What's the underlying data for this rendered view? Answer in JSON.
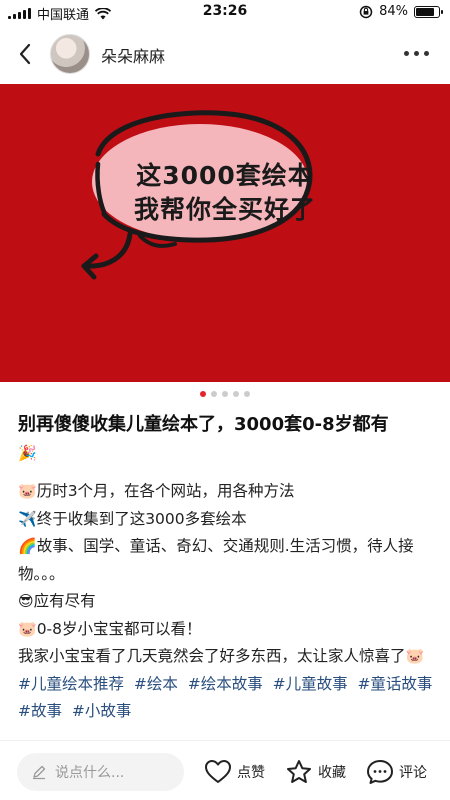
{
  "status_bar": {
    "carrier": "中国联通",
    "time": "23:26",
    "battery": "84%",
    "battery_level": 0.84
  },
  "header": {
    "author_name": "朵朵麻麻"
  },
  "cover": {
    "line1": "这3000套绘本",
    "line2": "我帮你全买好了",
    "colors": {
      "background": "#bf0d14",
      "bubble": "#f4b6bb"
    }
  },
  "pager": {
    "count": 5,
    "active_index": 0
  },
  "post": {
    "title": "别再傻傻收集儿童绘本了，3000套0-8岁都有",
    "title_emoji": "🎉",
    "lines": [
      {
        "emoji": "🐷",
        "text": "历时3个月，在各个网站，用各种方法"
      },
      {
        "emoji": "✈️",
        "text": "终于收集到了这3000多套绘本"
      },
      {
        "emoji": "🌈",
        "text": "故事、国学、童话、奇幻、交通规则.生活习惯，待人接物。。。"
      },
      {
        "emoji": "😎",
        "text": "应有尽有"
      },
      {
        "emoji": "🐷",
        "text": "0-8岁小宝宝都可以看！"
      }
    ],
    "last_paragraph": "我家小宝宝看了几天竟然会了好多东西，太让家人惊喜了",
    "last_emoji": "🐷",
    "tags": [
      "#儿童绘本推荐",
      "#绘本",
      "#绘本故事",
      "#儿童故事",
      "#童话故事",
      "#故事",
      "#小故事"
    ]
  },
  "bottom_bar": {
    "comment_placeholder": "说点什么...",
    "like_label": "点赞",
    "favorite_label": "收藏",
    "comment_label": "评论"
  }
}
